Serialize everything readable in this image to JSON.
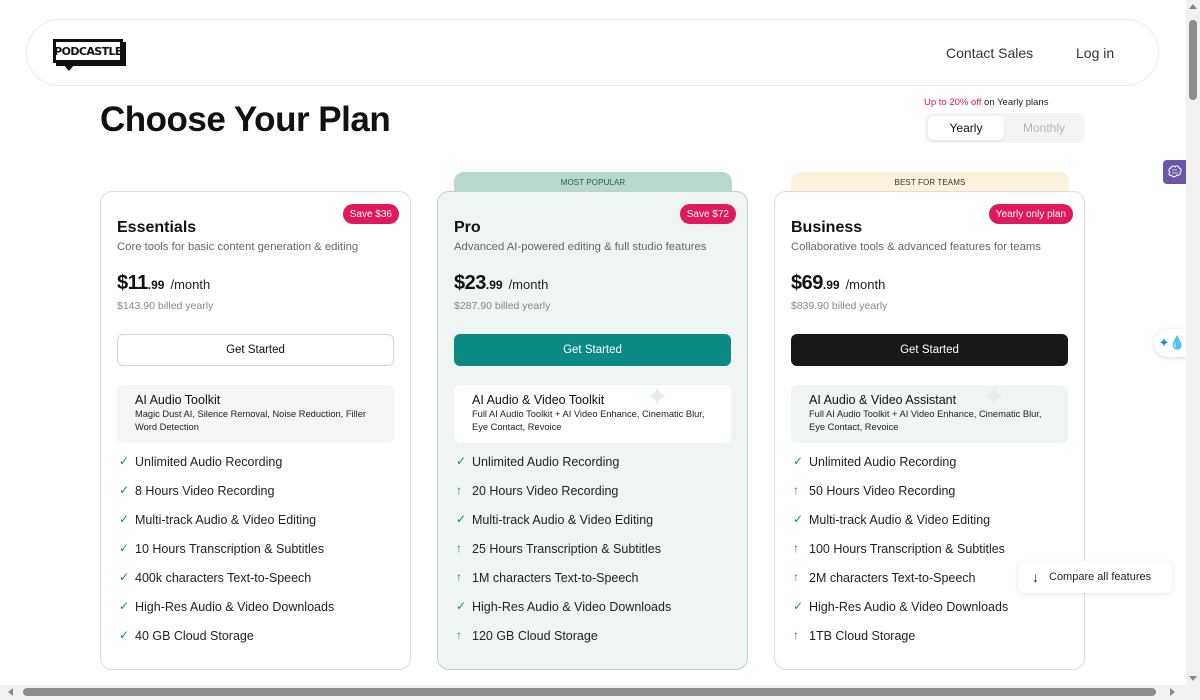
{
  "header": {
    "logo_text": "PODCASTLE",
    "nav": {
      "contact_sales": "Contact Sales",
      "log_in": "Log in"
    }
  },
  "page": {
    "title": "Choose Your Plan",
    "promo_highlight": "Up to 20% off",
    "promo_rest": " on Yearly plans",
    "billing_toggle": {
      "options": [
        "Yearly",
        "Monthly"
      ],
      "selected": "Yearly"
    }
  },
  "accent_colors": {
    "badge": "#e0185d",
    "teal": "#0a8a82",
    "dark": "#18181b",
    "popular_tag": "#b9d8cc",
    "teams_tag": "#fcf1dc"
  },
  "plans": [
    {
      "name": "Essentials",
      "badge": "Save $36",
      "description": "Core tools for basic content generation & editing",
      "price_main": "$11",
      "price_cents": ".99",
      "period": "/month",
      "billed": "$143.90 billed yearly",
      "cta": "Get Started",
      "toolkit_title": "AI Audio Toolkit",
      "toolkit_desc": "Magic Dust AI, Silence Removal, Noise Reduction, Filler Word Detection",
      "features": [
        {
          "icon": "check",
          "text": "Unlimited Audio Recording"
        },
        {
          "icon": "check",
          "text": "8 Hours Video Recording"
        },
        {
          "icon": "check",
          "text": "Multi-track Audio & Video Editing"
        },
        {
          "icon": "check",
          "text": "10 Hours Transcription & Subtitles"
        },
        {
          "icon": "check",
          "text": "400k characters Text-to-Speech"
        },
        {
          "icon": "check",
          "text": "High-Res Audio & Video Downloads"
        },
        {
          "icon": "check",
          "text": "40 GB Cloud Storage"
        }
      ]
    },
    {
      "name": "Pro",
      "tag": "MOST POPULAR",
      "badge": "Save $72",
      "description": "Advanced AI-powered editing & full studio features",
      "price_main": "$23",
      "price_cents": ".99",
      "period": "/month",
      "billed": "$287.90 billed yearly",
      "cta": "Get Started",
      "toolkit_title": "AI Audio & Video Toolkit",
      "toolkit_desc": "Full AI Audio Toolkit + AI Video Enhance, Cinematic Blur, Eye Contact, Revoice",
      "features": [
        {
          "icon": "check",
          "text": "Unlimited Audio Recording"
        },
        {
          "icon": "arrow-up",
          "text": "20 Hours Video Recording"
        },
        {
          "icon": "check",
          "text": "Multi-track Audio & Video Editing"
        },
        {
          "icon": "arrow-up",
          "text": "25 Hours Transcription & Subtitles"
        },
        {
          "icon": "arrow-up",
          "text": "1M characters Text-to-Speech"
        },
        {
          "icon": "check",
          "text": "High-Res Audio & Video Downloads"
        },
        {
          "icon": "arrow-up",
          "text": "120 GB Cloud Storage"
        }
      ]
    },
    {
      "name": "Business",
      "tag": "BEST FOR TEAMS",
      "badge": "Yearly only plan",
      "description": "Collaborative tools & advanced features for teams",
      "price_main": "$69",
      "price_cents": ".99",
      "period": "/month",
      "billed": "$839.90 billed yearly",
      "cta": "Get Started",
      "toolkit_title": "AI Audio & Video Assistant",
      "toolkit_desc": "Full AI Audio Toolkit + AI Video Enhance, Cinematic Blur, Eye Contact, Revoice",
      "features": [
        {
          "icon": "check",
          "text": "Unlimited Audio Recording"
        },
        {
          "icon": "arrow-up",
          "text": "50 Hours Video Recording"
        },
        {
          "icon": "check",
          "text": "Multi-track Audio & Video Editing"
        },
        {
          "icon": "arrow-up",
          "text": "100 Hours Transcription & Subtitles"
        },
        {
          "icon": "arrow-up",
          "text": "2M characters Text-to-Speech"
        },
        {
          "icon": "check",
          "text": "High-Res Audio & Video Downloads"
        },
        {
          "icon": "arrow-up",
          "text": "1TB Cloud Storage"
        }
      ]
    }
  ],
  "compare_button": {
    "icon": "arrow-down-icon",
    "label": "Compare all features"
  },
  "side_widgets": [
    "brain-icon",
    "water-drop-sparkle-icon"
  ]
}
